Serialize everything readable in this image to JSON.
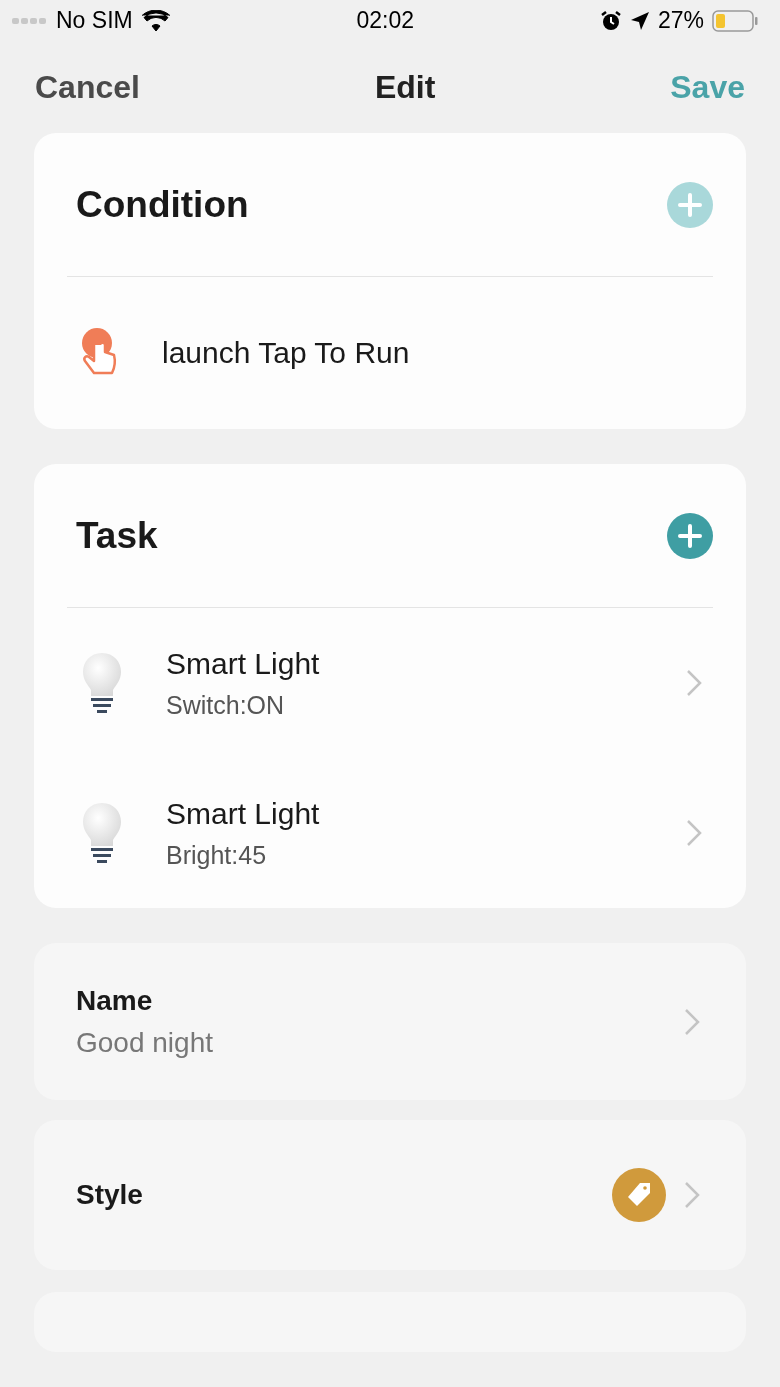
{
  "status_bar": {
    "carrier": "No SIM",
    "time": "02:02",
    "battery": "27%"
  },
  "nav": {
    "cancel": "Cancel",
    "title": "Edit",
    "save": "Save"
  },
  "condition": {
    "title": "Condition",
    "add_disabled": true,
    "items": [
      {
        "label": "launch Tap To Run"
      }
    ]
  },
  "task": {
    "title": "Task",
    "add_disabled": false,
    "items": [
      {
        "name": "Smart Light",
        "detail": "Switch:ON"
      },
      {
        "name": "Smart Light",
        "detail": "Bright:45"
      }
    ]
  },
  "settings": [
    {
      "kind": "value",
      "label": "Name",
      "value": "Good night"
    },
    {
      "kind": "style",
      "label": "Style"
    }
  ]
}
